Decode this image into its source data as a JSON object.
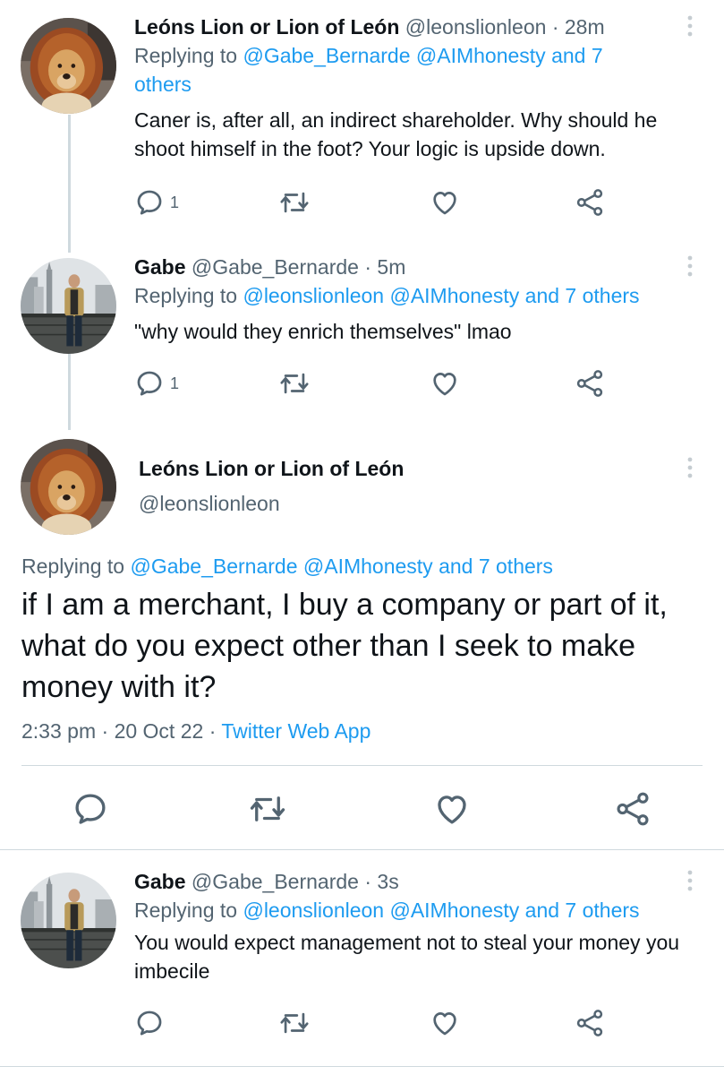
{
  "tweets": [
    {
      "name": "Leóns Lion or Lion of León",
      "handle": "@leonslionleon",
      "dot": "·",
      "time": "28m",
      "replying_label": "Replying to",
      "replying_mentions": "@Gabe_Bernarde @AIMhonesty and 7 others",
      "text": "Caner is, after all, an indirect shareholder. Why should he shoot himself in the foot? Your logic is upside down.",
      "reply_count": "1",
      "avatar_icon": "lion-dog-avatar"
    },
    {
      "name": "Gabe",
      "handle": "@Gabe_Bernarde",
      "dot": "·",
      "time": "5m",
      "replying_label": "Replying to",
      "replying_mentions": "@leonslionleon @AIMhonesty and 7 others",
      "text": "\"why would they enrich themselves\" lmao",
      "reply_count": "1",
      "avatar_icon": "man-city-avatar"
    }
  ],
  "main_tweet": {
    "name": "Leóns Lion or Lion of León",
    "handle": "@leonslionleon",
    "replying_label": "Replying to",
    "replying_mentions": "@Gabe_Bernarde @AIMhonesty and 7 others",
    "text": "if I am a merchant, I buy a company or part of it, what do you expect other than I seek to make money with it?",
    "time": "2:33 pm",
    "dot1": "·",
    "date": "20 Oct 22",
    "dot2": "·",
    "source": "Twitter Web App"
  },
  "last_tweet": {
    "name": "Gabe",
    "handle": "@Gabe_Bernarde",
    "dot": "·",
    "time": "3s",
    "replying_label": "Replying to",
    "replying_mentions": "@leonslionleon @AIMhonesty and 7 others",
    "text": "You would expect management not to steal your money you imbecile"
  },
  "colors": {
    "accent": "#1d9bf0",
    "secondary_text": "#536471",
    "primary_text": "#0f1419",
    "divider": "#cfd9de"
  },
  "icons": [
    "reply-icon",
    "retweet-icon",
    "like-icon",
    "share-icon",
    "more-icon"
  ]
}
